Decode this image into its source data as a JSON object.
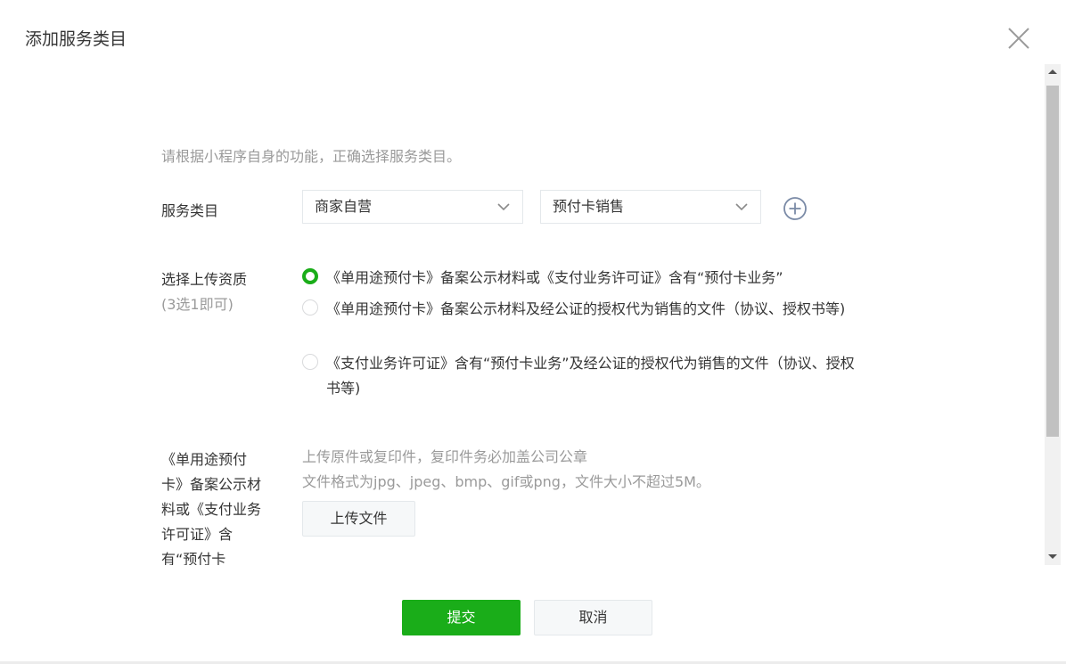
{
  "dialog": {
    "title": "添加服务类目",
    "close_icon": "close-icon"
  },
  "form": {
    "hint": "请根据小程序自身的功能，正确选择服务类目。",
    "category_label": "服务类目",
    "category_primary": "商家自营",
    "category_secondary": "预付卡销售",
    "add_icon": "plus-circle-icon",
    "qualification_label": "选择上传资质",
    "qualification_sub": "(3选1即可)",
    "options": [
      {
        "text": "《单用途预付卡》备案公示材料或《支付业务许可证》含有“预付卡业务”",
        "checked": true
      },
      {
        "text": "《单用途预付卡》备案公示材料及经公证的授权代为销售的文件（协议、授权书等)",
        "checked": false
      },
      {
        "text": "《支付业务许可证》含有“预付卡业务”及经公证的授权代为销售的文件（协议、授权书等)",
        "checked": false
      }
    ],
    "upload_label": "《单用途预付卡》备案公示材料或《支付业务许可证》含有“预付卡",
    "upload_tip_1": "上传原件或复印件，复印件务必加盖公司公章",
    "upload_tip_2": "文件格式为jpg、jpeg、bmp、gif或png，文件大小不超过5M。",
    "upload_button": "上传文件"
  },
  "footer": {
    "submit": "提交",
    "cancel": "取消"
  },
  "colors": {
    "primary": "#1aad19",
    "border": "#e4e8eb",
    "hint": "#9a9a9a",
    "text": "#353535"
  }
}
